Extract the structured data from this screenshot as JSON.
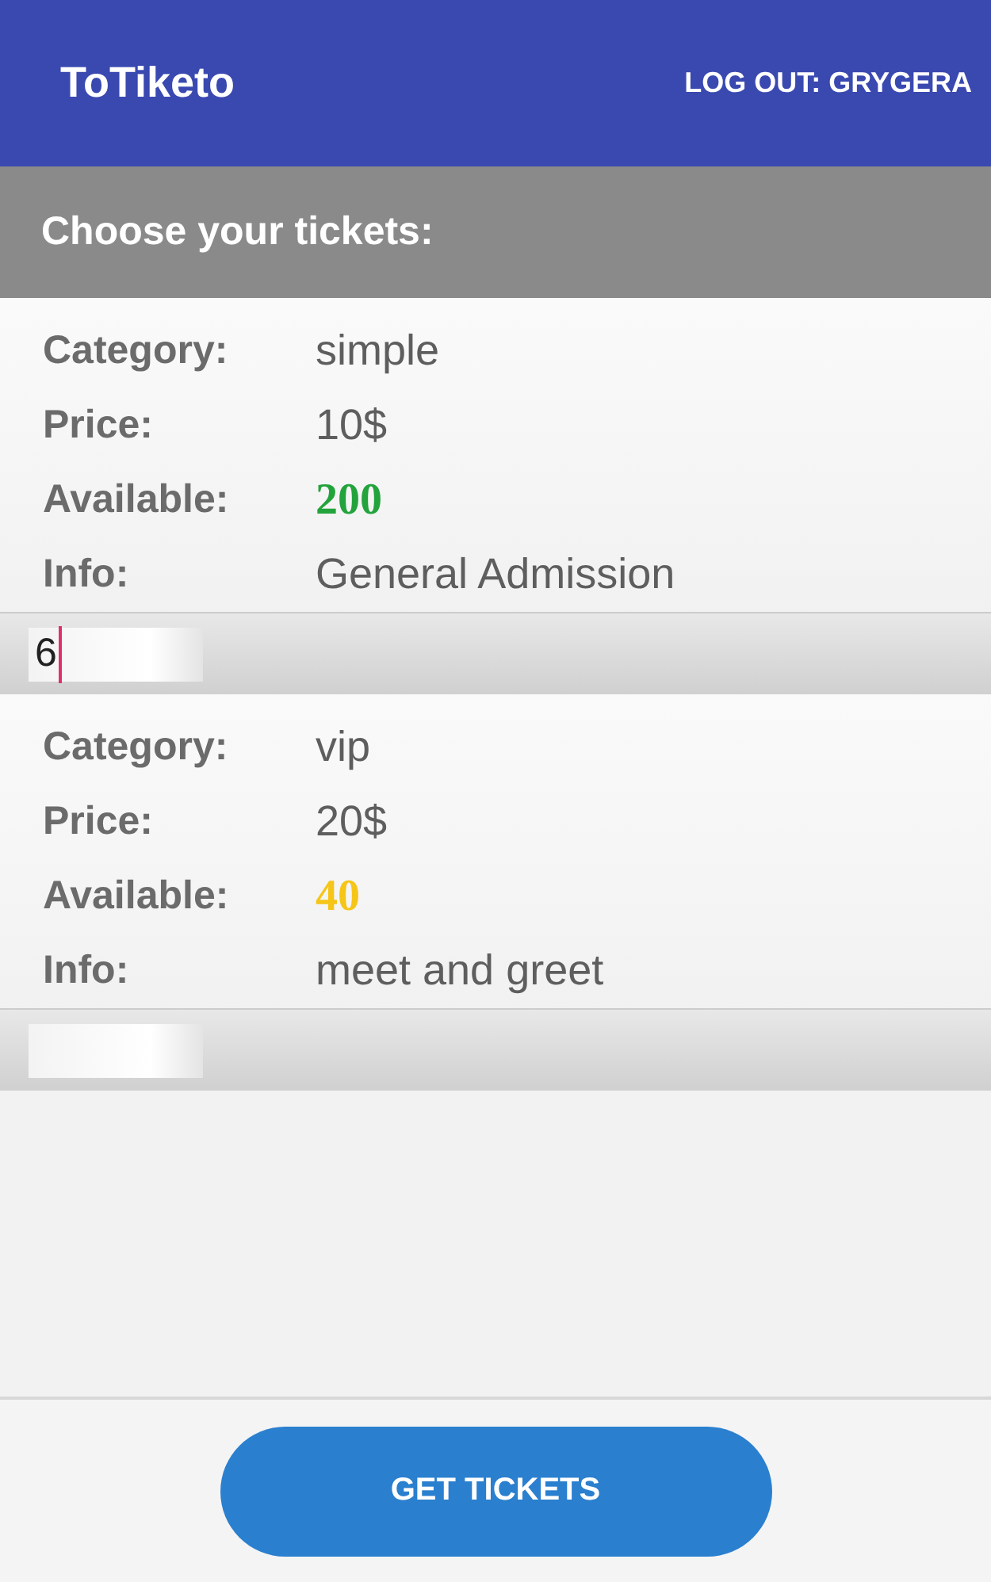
{
  "app_bar": {
    "title": "ToTiketo",
    "action": "LOG OUT: GRYGERA"
  },
  "heading": "Choose your tickets:",
  "tickets": [
    {
      "fields": [
        {
          "label": "Category:",
          "value": "simple"
        },
        {
          "label": "Price:",
          "value": "10$"
        },
        {
          "label": "Available:",
          "value": "200",
          "color": "#23a33c"
        },
        {
          "label": "Info:",
          "value": "General Admission"
        }
      ],
      "quantity": {
        "value": "6",
        "focused": true
      }
    },
    {
      "fields": [
        {
          "label": "Category:",
          "value": "vip"
        },
        {
          "label": "Price:",
          "value": "20$"
        },
        {
          "label": "Available:",
          "value": "40",
          "color": "#f5c518"
        },
        {
          "label": "Info:",
          "value": "meet and greet"
        }
      ],
      "quantity": {
        "focused": false
      }
    }
  ],
  "button": "GET TICKETS"
}
